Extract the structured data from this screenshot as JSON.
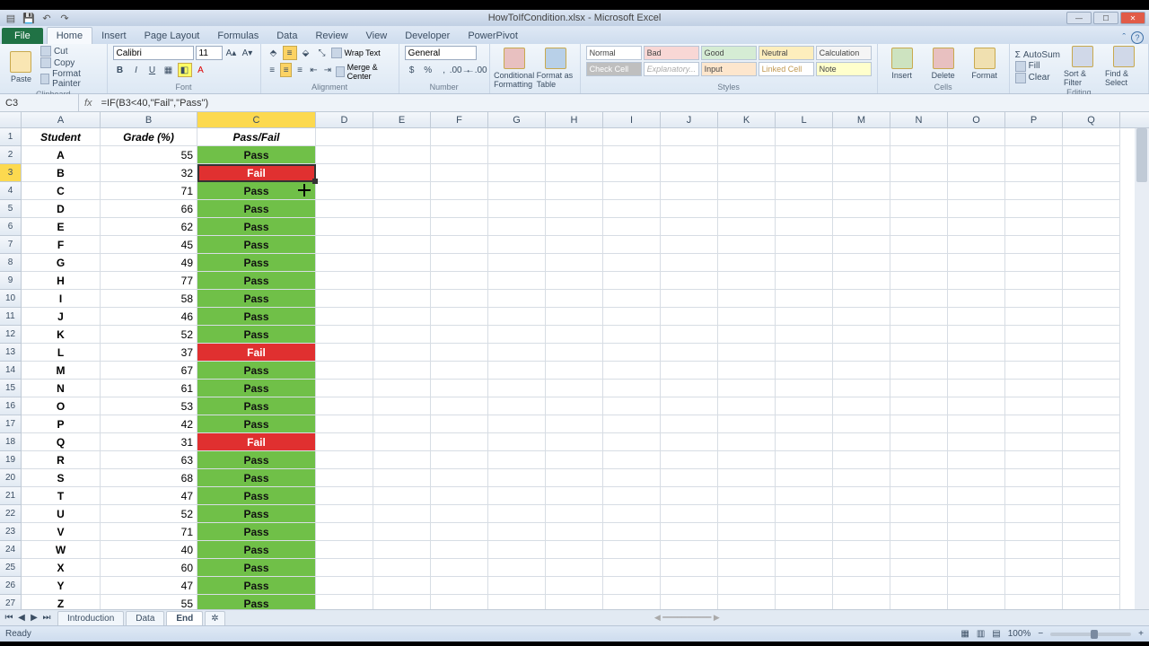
{
  "title": "HowToIfCondition.xlsx - Microsoft Excel",
  "ribbon": {
    "file": "File",
    "tabs": [
      "Home",
      "Insert",
      "Page Layout",
      "Formulas",
      "Data",
      "Review",
      "View",
      "Developer",
      "PowerPivot"
    ],
    "clipboard": {
      "label": "Clipboard",
      "paste": "Paste",
      "cut": "Cut",
      "copy": "Copy",
      "format_painter": "Format Painter"
    },
    "font": {
      "label": "Font",
      "name": "Calibri",
      "size": "11"
    },
    "alignment": {
      "label": "Alignment",
      "wrap": "Wrap Text",
      "merge": "Merge & Center"
    },
    "number": {
      "label": "Number",
      "format": "General"
    },
    "styles": {
      "label": "Styles",
      "cond": "Conditional Formatting",
      "table": "Format as Table",
      "cells": [
        "Normal",
        "Bad",
        "Good",
        "Neutral",
        "Calculation",
        "Check Cell",
        "Explanatory...",
        "Input",
        "Linked Cell",
        "Note"
      ]
    },
    "cells": {
      "label": "Cells",
      "insert": "Insert",
      "delete": "Delete",
      "format": "Format"
    },
    "editing": {
      "label": "Editing",
      "autosum": "AutoSum",
      "fill": "Fill",
      "clear": "Clear",
      "sort": "Sort & Filter",
      "find": "Find & Select"
    }
  },
  "formula_bar": {
    "cell_ref": "C3",
    "formula": "=IF(B3<40,\"Fail\",\"Pass\")"
  },
  "grid": {
    "cols": [
      "A",
      "B",
      "C",
      "D",
      "E",
      "F",
      "G",
      "H",
      "I",
      "J",
      "K",
      "L",
      "M",
      "N",
      "O",
      "P",
      "Q"
    ],
    "headers": {
      "A": "Student",
      "B": "Grade (%)",
      "C": "Pass/Fail"
    },
    "selected_row": 3,
    "rows": [
      {
        "n": 2,
        "student": "A",
        "grade": 55,
        "result": "Pass"
      },
      {
        "n": 3,
        "student": "B",
        "grade": 32,
        "result": "Fail"
      },
      {
        "n": 4,
        "student": "C",
        "grade": 71,
        "result": "Pass"
      },
      {
        "n": 5,
        "student": "D",
        "grade": 66,
        "result": "Pass"
      },
      {
        "n": 6,
        "student": "E",
        "grade": 62,
        "result": "Pass"
      },
      {
        "n": 7,
        "student": "F",
        "grade": 45,
        "result": "Pass"
      },
      {
        "n": 8,
        "student": "G",
        "grade": 49,
        "result": "Pass"
      },
      {
        "n": 9,
        "student": "H",
        "grade": 77,
        "result": "Pass"
      },
      {
        "n": 10,
        "student": "I",
        "grade": 58,
        "result": "Pass"
      },
      {
        "n": 11,
        "student": "J",
        "grade": 46,
        "result": "Pass"
      },
      {
        "n": 12,
        "student": "K",
        "grade": 52,
        "result": "Pass"
      },
      {
        "n": 13,
        "student": "L",
        "grade": 37,
        "result": "Fail"
      },
      {
        "n": 14,
        "student": "M",
        "grade": 67,
        "result": "Pass"
      },
      {
        "n": 15,
        "student": "N",
        "grade": 61,
        "result": "Pass"
      },
      {
        "n": 16,
        "student": "O",
        "grade": 53,
        "result": "Pass"
      },
      {
        "n": 17,
        "student": "P",
        "grade": 42,
        "result": "Pass"
      },
      {
        "n": 18,
        "student": "Q",
        "grade": 31,
        "result": "Fail"
      },
      {
        "n": 19,
        "student": "R",
        "grade": 63,
        "result": "Pass"
      },
      {
        "n": 20,
        "student": "S",
        "grade": 68,
        "result": "Pass"
      },
      {
        "n": 21,
        "student": "T",
        "grade": 47,
        "result": "Pass"
      },
      {
        "n": 22,
        "student": "U",
        "grade": 52,
        "result": "Pass"
      },
      {
        "n": 23,
        "student": "V",
        "grade": 71,
        "result": "Pass"
      },
      {
        "n": 24,
        "student": "W",
        "grade": 40,
        "result": "Pass"
      },
      {
        "n": 25,
        "student": "X",
        "grade": 60,
        "result": "Pass"
      },
      {
        "n": 26,
        "student": "Y",
        "grade": 47,
        "result": "Pass"
      },
      {
        "n": 27,
        "student": "Z",
        "grade": 55,
        "result": "Pass"
      }
    ]
  },
  "sheets": [
    "Introduction",
    "Data",
    "End"
  ],
  "status": {
    "mode": "Ready",
    "zoom": "100%"
  },
  "colors": {
    "pass": "#70c048",
    "fail": "#e03030",
    "col_highlight": "#fcd94f"
  }
}
